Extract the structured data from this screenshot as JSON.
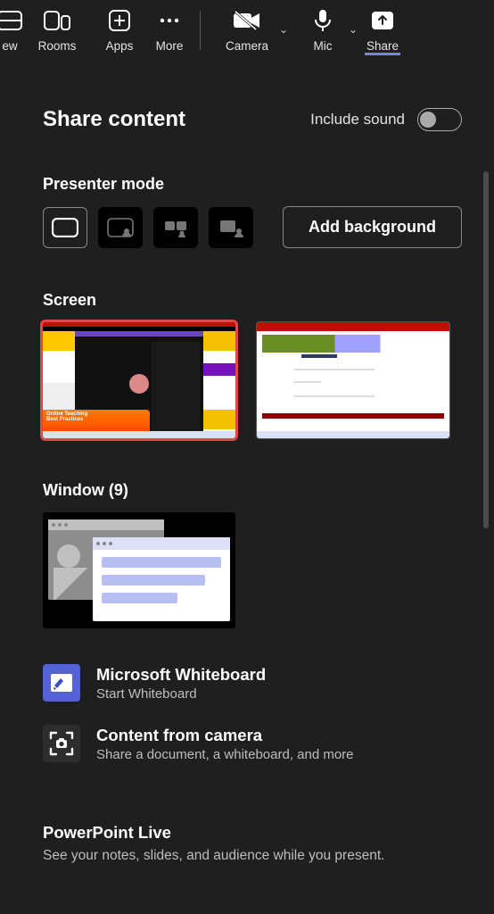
{
  "toolbar": {
    "view_label": "ew",
    "rooms_label": "Rooms",
    "apps_label": "Apps",
    "more_label": "More",
    "camera_label": "Camera",
    "mic_label": "Mic",
    "share_label": "Share"
  },
  "share": {
    "title": "Share content",
    "include_sound_label": "Include sound",
    "include_sound_on": false,
    "presenter_mode_label": "Presenter mode",
    "add_background_label": "Add background",
    "screen_label": "Screen",
    "screen1_banner1": "Online Teaching",
    "screen1_banner2": "Best Practices",
    "window_label": "Window (9)",
    "whiteboard_title": "Microsoft Whiteboard",
    "whiteboard_sub": "Start Whiteboard",
    "camera_title": "Content from camera",
    "camera_sub": "Share a document, a whiteboard, and more",
    "ppt_title": "PowerPoint Live",
    "ppt_sub": "See your notes, slides, and audience while you present."
  }
}
